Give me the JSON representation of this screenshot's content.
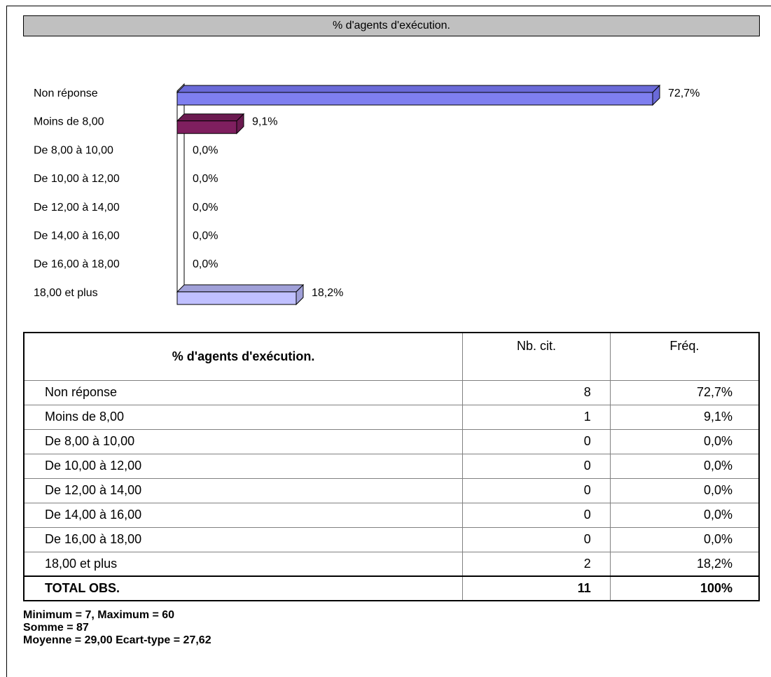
{
  "title": "% d'agents d'exécution.",
  "chart_data": {
    "type": "bar",
    "orientation": "horizontal",
    "title": "% d'agents d'exécution.",
    "categories": [
      "Non réponse",
      "Moins de 8,00",
      "De 8,00 à 10,00",
      "De 10,00 à 12,00",
      "De 12,00 à 14,00",
      "De 14,00 à 16,00",
      "De 16,00 à 18,00",
      "18,00 et plus"
    ],
    "values": [
      72.7,
      9.1,
      0.0,
      0.0,
      0.0,
      0.0,
      0.0,
      18.2
    ],
    "value_labels": [
      "72,7%",
      "9,1%",
      "0,0%",
      "0,0%",
      "0,0%",
      "0,0%",
      "0,0%",
      "18,2%"
    ],
    "colors": [
      "#7f7ff0",
      "#7f1f5f",
      "#7f7ff0",
      "#7f7ff0",
      "#7f7ff0",
      "#7f7ff0",
      "#7f7ff0",
      "#c0c0ff"
    ],
    "top_colors": [
      "#6a6ad8",
      "#6b1a50",
      "#6a6ad8",
      "#6a6ad8",
      "#6a6ad8",
      "#6a6ad8",
      "#6a6ad8",
      "#a0a0d8"
    ],
    "xlim": [
      0,
      75
    ]
  },
  "table": {
    "header": {
      "label": "% d'agents d'exécution.",
      "count": "Nb. cit.",
      "freq": "Fréq."
    },
    "rows": [
      {
        "label": "Non réponse",
        "count": "8",
        "freq": "72,7%"
      },
      {
        "label": "Moins de 8,00",
        "count": "1",
        "freq": "9,1%"
      },
      {
        "label": "De 8,00 à 10,00",
        "count": "0",
        "freq": "0,0%"
      },
      {
        "label": "De 10,00 à 12,00",
        "count": "0",
        "freq": "0,0%"
      },
      {
        "label": "De 12,00 à 14,00",
        "count": "0",
        "freq": "0,0%"
      },
      {
        "label": "De 14,00 à 16,00",
        "count": "0",
        "freq": "0,0%"
      },
      {
        "label": "De 16,00 à 18,00",
        "count": "0",
        "freq": "0,0%"
      },
      {
        "label": "18,00 et plus",
        "count": "2",
        "freq": "18,2%"
      }
    ],
    "total": {
      "label": "TOTAL OBS.",
      "count": "11",
      "freq": "100%"
    }
  },
  "stats": {
    "line1": "Minimum = 7, Maximum = 60",
    "line2": "Somme = 87",
    "line3": "Moyenne = 29,00  Ecart-type = 27,62"
  }
}
